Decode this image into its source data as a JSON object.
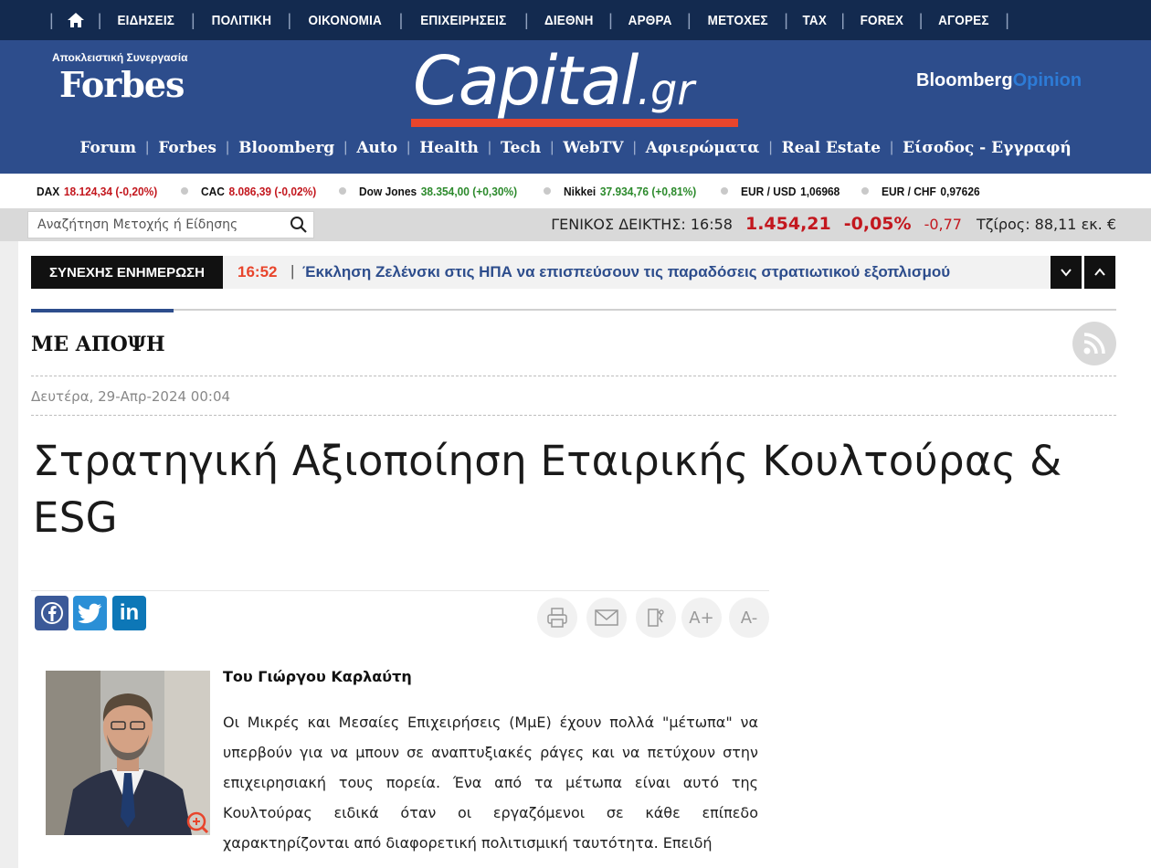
{
  "topnav": {
    "items": [
      "ΕΙΔΗΣΕΙΣ",
      "ΠΟΛΙΤΙΚΗ",
      "ΟΙΚΟΝΟΜΙΑ",
      "ΕΠΙΧΕΙΡΗΣΕΙΣ",
      "ΔΙΕΘΝΗ",
      "ΑΡΘΡΑ",
      "ΜΕΤΟΧΕΣ",
      "TAX",
      "FOREX",
      "ΑΓΟΡΕΣ"
    ]
  },
  "header": {
    "forbes_tag": "Αποκλειστική Συνεργασία",
    "forbes_logo": "Forbes",
    "capital_main": "Capital",
    "capital_suffix": ".gr",
    "bloomberg_main": "Bloomberg",
    "bloomberg_sub": "Opinion",
    "subnav": [
      "Forum",
      "Forbes",
      "Bloomberg",
      "Auto",
      "Health",
      "Tech",
      "WebTV",
      "Αφιερώματα",
      "Real Estate",
      "Είσοδος - Εγγραφή"
    ]
  },
  "ticker": [
    {
      "name": "DAX",
      "value": "18.124,34 (-0,20%)",
      "trend": "down"
    },
    {
      "name": "CAC",
      "value": "8.086,39 (-0,02%)",
      "trend": "down"
    },
    {
      "name": "Dow Jones",
      "value": "38.354,00 (+0,30%)",
      "trend": "up"
    },
    {
      "name": "Nikkei",
      "value": "37.934,76 (+0,81%)",
      "trend": "up"
    },
    {
      "name": "EUR / USD",
      "value": "1,06968",
      "trend": "neutral"
    },
    {
      "name": "EUR / CHF",
      "value": "0,97626",
      "trend": "neutral"
    }
  ],
  "search": {
    "placeholder": "Αναζήτηση Μετοχής ή Είδησης",
    "index_label": "ΓΕΝΙΚΟΣ ΔΕΙΚΤΗΣ: 16:58",
    "index_value": "1.454,21",
    "index_pct": "-0,05%",
    "index_change": "-0,77",
    "turnover": "Τζίρος: 88,11 εκ. €"
  },
  "news": {
    "label": "ΣΥΝΕΧΗΣ ΕΝΗΜΕΡΩΣΗ",
    "time": "16:52",
    "headline": "Έκκληση Ζελένσκι στις ΗΠΑ να επισπεύσουν τις παραδόσεις στρατιωτικού εξοπλισμού"
  },
  "article": {
    "section": "ΜΕ ΑΠΟΨΗ",
    "date": "Δευτέρα, 29-Απρ-2024 00:04",
    "title": "Στρατηγική Αξιοποίηση Εταιρικής Κουλτούρας & ESG",
    "author": "Του Γιώργου Καρλαύτη",
    "body": "Οι Μικρές και Μεσαίες Επιχειρήσεις (ΜμΕ) έχουν πολλά \"μέτωπα\" να υπερβούν για να μπουν σε αναπτυξιακές ράγες και να πετύχουν στην επιχειρησιακή τους πορεία. Ένα από τα μέτωπα είναι αυτό της Κουλτούρας ειδικά όταν οι εργαζόμενοι σε κάθε επίπεδο χαρακτηρίζονται από διαφορετική πολιτισμική ταυτότητα. Επειδή"
  },
  "tools": {
    "font_up": "A+",
    "font_down": "A-"
  },
  "colors": {
    "nav_bg": "#132a4f",
    "header_bg": "#2d4d8c",
    "accent_red": "#e8452c",
    "down": "#c3171e",
    "up": "#2c8a2c"
  }
}
